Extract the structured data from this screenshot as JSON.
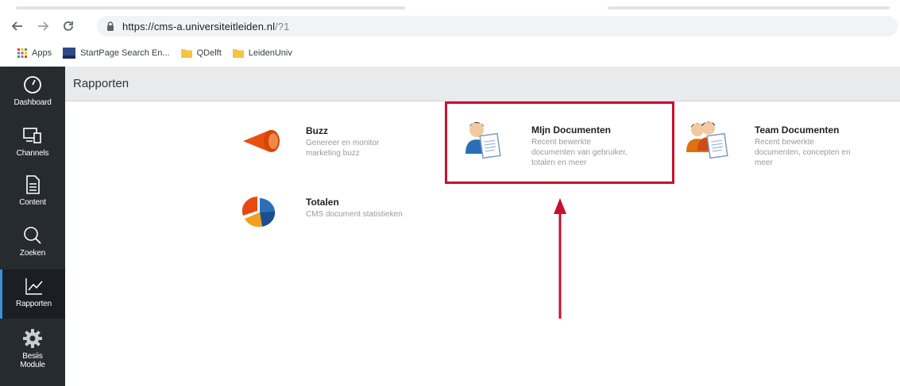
{
  "browser": {
    "url_domain": "https://cms-a.universiteitleiden.nl",
    "url_path": "/?1"
  },
  "bookmarks": [
    {
      "label": "Apps",
      "icon": "apps-grid-icon"
    },
    {
      "label": "StartPage Search En...",
      "icon": "startpage-icon"
    },
    {
      "label": "QDelft",
      "icon": "folder-icon"
    },
    {
      "label": "LeidenUniv",
      "icon": "folder-icon"
    }
  ],
  "sidebar": {
    "items": [
      {
        "label": "Dashboard",
        "icon": "dashboard-icon"
      },
      {
        "label": "Channels",
        "icon": "channels-icon"
      },
      {
        "label": "Content",
        "icon": "content-icon"
      },
      {
        "label": "Zoeken",
        "icon": "search-icon"
      },
      {
        "label": "Rapporten",
        "icon": "chart-icon",
        "active": true
      },
      {
        "label": "Besiis",
        "label2": "Module",
        "icon": "gear-icon"
      }
    ]
  },
  "page": {
    "title": "Rapporten"
  },
  "cards": [
    {
      "title": "Buzz",
      "desc1": "Genereer en monitor",
      "desc2": "marketing buzz",
      "desc3": "",
      "icon": "megaphone-icon"
    },
    {
      "title": "MIjn Documenten",
      "desc1": "Recent bewerkte",
      "desc2": "documenten van gebruiker,",
      "desc3": "totalen en meer",
      "icon": "user-document-icon"
    },
    {
      "title": "Team Documenten",
      "desc1": "Recent bewerkte",
      "desc2": "documenten, concepten en",
      "desc3": "meer",
      "icon": "team-document-icon"
    },
    {
      "title": "Totalen",
      "desc1": "CMS document statistieken",
      "desc2": "",
      "desc3": "",
      "icon": "pie-chart-icon"
    }
  ],
  "colors": {
    "sidebar_bg": "#262b30",
    "highlight": "#c8102e",
    "active_accent": "#3a8fd6"
  }
}
